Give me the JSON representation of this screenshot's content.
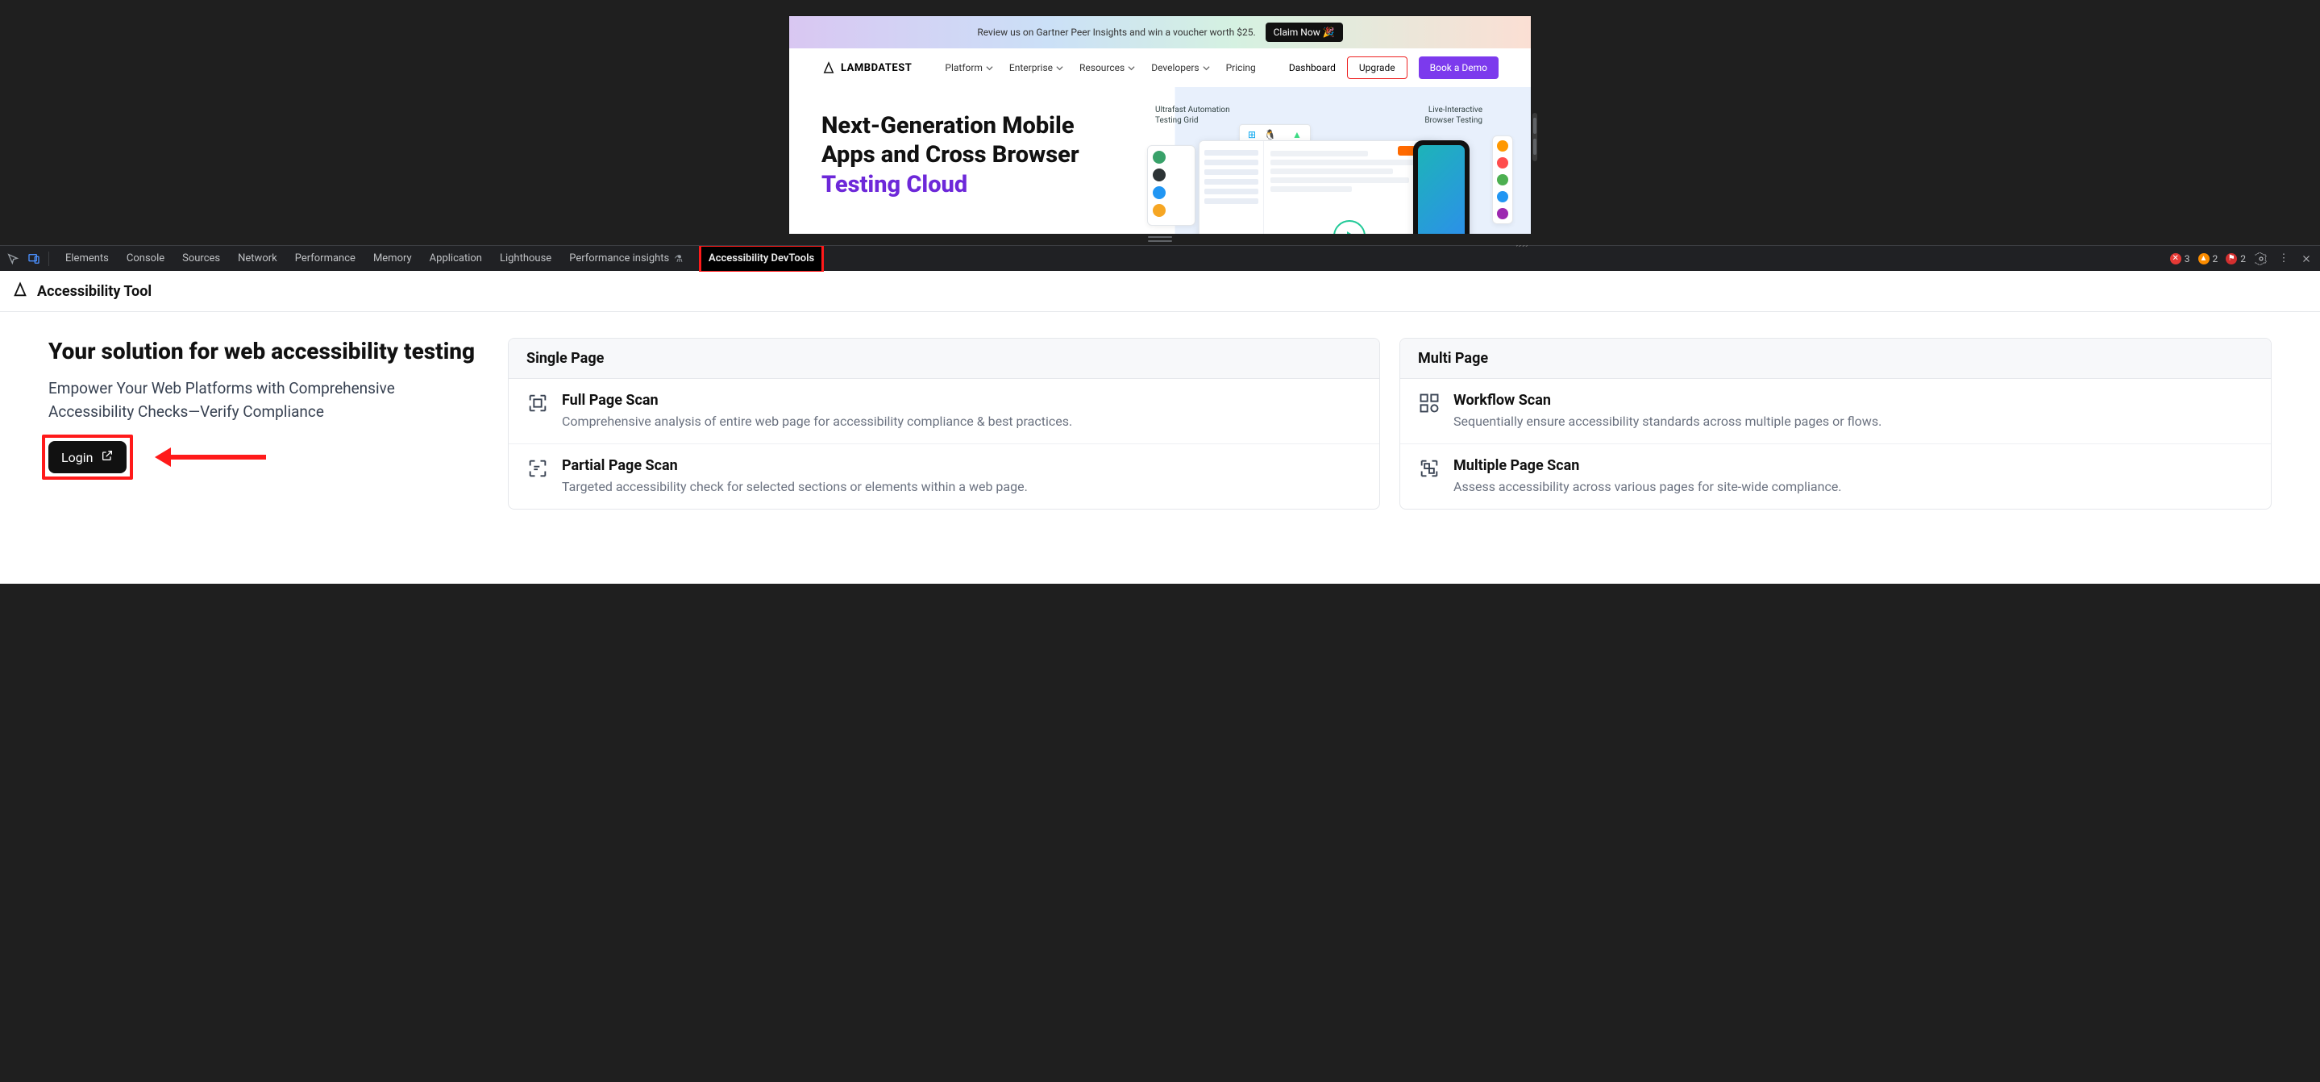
{
  "promo": {
    "text": "Review us on Gartner Peer Insights and win a voucher worth $25.",
    "button": "Claim Now 🎉"
  },
  "brand": "LAMBDATEST",
  "nav": {
    "platform": "Platform",
    "enterprise": "Enterprise",
    "resources": "Resources",
    "developers": "Developers",
    "pricing": "Pricing"
  },
  "header_actions": {
    "dashboard": "Dashboard",
    "upgrade": "Upgrade",
    "book": "Book a Demo"
  },
  "hero": {
    "line1": "Next-Generation Mobile",
    "line2": "Apps and Cross Browser",
    "line3": "Testing Cloud",
    "callout_left_a": "Ultrafast Automation",
    "callout_left_b": "Testing Grid",
    "callout_right_a": "Live-Interactive",
    "callout_right_b": "Browser Testing"
  },
  "devtools_tabs": {
    "elements": "Elements",
    "console": "Console",
    "sources": "Sources",
    "network": "Network",
    "performance": "Performance",
    "memory": "Memory",
    "application": "Application",
    "lighthouse": "Lighthouse",
    "perf_insights": "Performance insights",
    "a11y": "Accessibility DevTools"
  },
  "devtools_status": {
    "errors": "3",
    "warnings": "2",
    "notices": "2"
  },
  "panel": {
    "tool_title": "Accessibility Tool",
    "heading": "Your solution for web accessibility testing",
    "sub": "Empower Your Web Platforms with Comprehensive Accessibility Checks—Verify Compliance",
    "login": "Login"
  },
  "cards": {
    "single": {
      "title": "Single Page",
      "full": {
        "h": "Full Page Scan",
        "p": "Comprehensive analysis of entire web page for accessibility compliance & best practices."
      },
      "partial": {
        "h": "Partial Page Scan",
        "p": "Targeted accessibility check for selected sections or elements within a web page."
      }
    },
    "multi": {
      "title": "Multi Page",
      "workflow": {
        "h": "Workflow Scan",
        "p": "Sequentially ensure accessibility standards across multiple pages or flows."
      },
      "multiple": {
        "h": "Multiple Page Scan",
        "p": "Assess accessibility across various pages for site-wide compliance."
      }
    }
  }
}
